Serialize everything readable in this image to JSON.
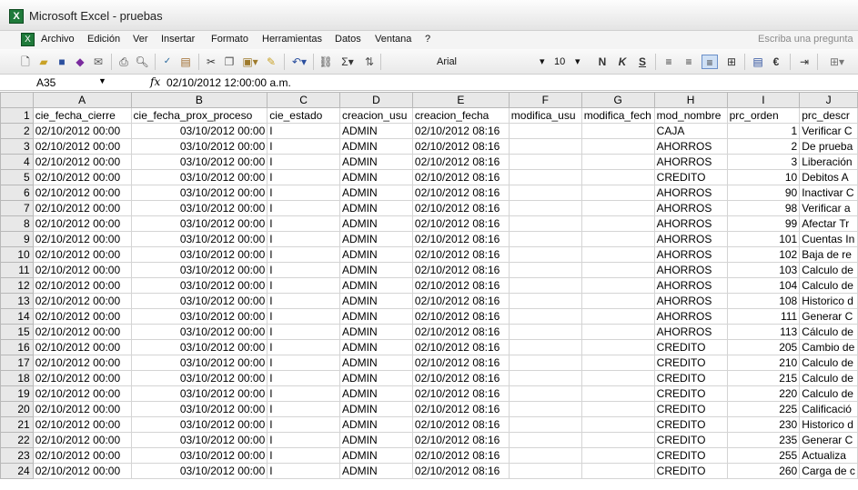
{
  "window": {
    "title": "Microsoft Excel - pruebas",
    "app_icon": "excel-icon"
  },
  "menu": {
    "items": [
      "Archivo",
      "Edición",
      "Ver",
      "Insertar",
      "Formato",
      "Herramientas",
      "Datos",
      "Ventana",
      "?"
    ],
    "help_placeholder": "Escriba una pregunta"
  },
  "toolbar": {
    "font_name": "Arial",
    "font_size": "10",
    "bold": "N",
    "italic": "K",
    "underline": "S",
    "sum": "Σ",
    "currency": "€"
  },
  "formula_bar": {
    "cell_ref": "A35",
    "fx": "fx",
    "value": "02/10/2012  12:00:00 a.m."
  },
  "sheet": {
    "columns": [
      "A",
      "B",
      "C",
      "D",
      "E",
      "F",
      "G",
      "H",
      "I",
      "J"
    ],
    "headers": [
      "cie_fecha_cierre",
      "cie_fecha_prox_proceso",
      "cie_estado",
      "creacion_usu",
      "creacion_fecha",
      "modifica_usu",
      "modifica_fech",
      "mod_nombre",
      "prc_orden",
      "prc_descr"
    ],
    "rows": [
      {
        "n": "2",
        "a": "02/10/2012 00:00",
        "b": "03/10/2012 00:00",
        "c": "I",
        "d": "ADMIN",
        "e": "02/10/2012 08:16",
        "f": "",
        "g": "",
        "h": "CAJA",
        "i": "1",
        "j": "Verificar C"
      },
      {
        "n": "3",
        "a": "02/10/2012 00:00",
        "b": "03/10/2012 00:00",
        "c": "I",
        "d": "ADMIN",
        "e": "02/10/2012 08:16",
        "f": "",
        "g": "",
        "h": "AHORROS",
        "i": "2",
        "j": "De prueba"
      },
      {
        "n": "4",
        "a": "02/10/2012 00:00",
        "b": "03/10/2012 00:00",
        "c": "I",
        "d": "ADMIN",
        "e": "02/10/2012 08:16",
        "f": "",
        "g": "",
        "h": "AHORROS",
        "i": "3",
        "j": "Liberación"
      },
      {
        "n": "5",
        "a": "02/10/2012 00:00",
        "b": "03/10/2012 00:00",
        "c": "I",
        "d": "ADMIN",
        "e": "02/10/2012 08:16",
        "f": "",
        "g": "",
        "h": "CREDITO",
        "i": "10",
        "j": "Debitos A"
      },
      {
        "n": "6",
        "a": "02/10/2012 00:00",
        "b": "03/10/2012 00:00",
        "c": "I",
        "d": "ADMIN",
        "e": "02/10/2012 08:16",
        "f": "",
        "g": "",
        "h": "AHORROS",
        "i": "90",
        "j": "Inactivar C"
      },
      {
        "n": "7",
        "a": "02/10/2012 00:00",
        "b": "03/10/2012 00:00",
        "c": "I",
        "d": "ADMIN",
        "e": "02/10/2012 08:16",
        "f": "",
        "g": "",
        "h": "AHORROS",
        "i": "98",
        "j": "Verificar a"
      },
      {
        "n": "8",
        "a": "02/10/2012 00:00",
        "b": "03/10/2012 00:00",
        "c": "I",
        "d": "ADMIN",
        "e": "02/10/2012 08:16",
        "f": "",
        "g": "",
        "h": "AHORROS",
        "i": "99",
        "j": "Afectar Tr"
      },
      {
        "n": "9",
        "a": "02/10/2012 00:00",
        "b": "03/10/2012 00:00",
        "c": "I",
        "d": "ADMIN",
        "e": "02/10/2012 08:16",
        "f": "",
        "g": "",
        "h": "AHORROS",
        "i": "101",
        "j": "Cuentas In"
      },
      {
        "n": "10",
        "a": "02/10/2012 00:00",
        "b": "03/10/2012 00:00",
        "c": "I",
        "d": "ADMIN",
        "e": "02/10/2012 08:16",
        "f": "",
        "g": "",
        "h": "AHORROS",
        "i": "102",
        "j": "Baja de re"
      },
      {
        "n": "11",
        "a": "02/10/2012 00:00",
        "b": "03/10/2012 00:00",
        "c": "I",
        "d": "ADMIN",
        "e": "02/10/2012 08:16",
        "f": "",
        "g": "",
        "h": "AHORROS",
        "i": "103",
        "j": "Calculo de"
      },
      {
        "n": "12",
        "a": "02/10/2012 00:00",
        "b": "03/10/2012 00:00",
        "c": "I",
        "d": "ADMIN",
        "e": "02/10/2012 08:16",
        "f": "",
        "g": "",
        "h": "AHORROS",
        "i": "104",
        "j": "Calculo de"
      },
      {
        "n": "13",
        "a": "02/10/2012 00:00",
        "b": "03/10/2012 00:00",
        "c": "I",
        "d": "ADMIN",
        "e": "02/10/2012 08:16",
        "f": "",
        "g": "",
        "h": "AHORROS",
        "i": "108",
        "j": "Historico d"
      },
      {
        "n": "14",
        "a": "02/10/2012 00:00",
        "b": "03/10/2012 00:00",
        "c": "I",
        "d": "ADMIN",
        "e": "02/10/2012 08:16",
        "f": "",
        "g": "",
        "h": "AHORROS",
        "i": "111",
        "j": "Generar C"
      },
      {
        "n": "15",
        "a": "02/10/2012 00:00",
        "b": "03/10/2012 00:00",
        "c": "I",
        "d": "ADMIN",
        "e": "02/10/2012 08:16",
        "f": "",
        "g": "",
        "h": "AHORROS",
        "i": "113",
        "j": "Cálculo de"
      },
      {
        "n": "16",
        "a": "02/10/2012 00:00",
        "b": "03/10/2012 00:00",
        "c": "I",
        "d": "ADMIN",
        "e": "02/10/2012 08:16",
        "f": "",
        "g": "",
        "h": "CREDITO",
        "i": "205",
        "j": "Cambio de"
      },
      {
        "n": "17",
        "a": "02/10/2012 00:00",
        "b": "03/10/2012 00:00",
        "c": "I",
        "d": "ADMIN",
        "e": "02/10/2012 08:16",
        "f": "",
        "g": "",
        "h": "CREDITO",
        "i": "210",
        "j": "Calculo de"
      },
      {
        "n": "18",
        "a": "02/10/2012 00:00",
        "b": "03/10/2012 00:00",
        "c": "I",
        "d": "ADMIN",
        "e": "02/10/2012 08:16",
        "f": "",
        "g": "",
        "h": "CREDITO",
        "i": "215",
        "j": "Calculo de"
      },
      {
        "n": "19",
        "a": "02/10/2012 00:00",
        "b": "03/10/2012 00:00",
        "c": "I",
        "d": "ADMIN",
        "e": "02/10/2012 08:16",
        "f": "",
        "g": "",
        "h": "CREDITO",
        "i": "220",
        "j": "Calculo de"
      },
      {
        "n": "20",
        "a": "02/10/2012 00:00",
        "b": "03/10/2012 00:00",
        "c": "I",
        "d": "ADMIN",
        "e": "02/10/2012 08:16",
        "f": "",
        "g": "",
        "h": "CREDITO",
        "i": "225",
        "j": "Calificació"
      },
      {
        "n": "21",
        "a": "02/10/2012 00:00",
        "b": "03/10/2012 00:00",
        "c": "I",
        "d": "ADMIN",
        "e": "02/10/2012 08:16",
        "f": "",
        "g": "",
        "h": "CREDITO",
        "i": "230",
        "j": "Historico d"
      },
      {
        "n": "22",
        "a": "02/10/2012 00:00",
        "b": "03/10/2012 00:00",
        "c": "I",
        "d": "ADMIN",
        "e": "02/10/2012 08:16",
        "f": "",
        "g": "",
        "h": "CREDITO",
        "i": "235",
        "j": "Generar C"
      },
      {
        "n": "23",
        "a": "02/10/2012 00:00",
        "b": "03/10/2012 00:00",
        "c": "I",
        "d": "ADMIN",
        "e": "02/10/2012 08:16",
        "f": "",
        "g": "",
        "h": "CREDITO",
        "i": "255",
        "j": "Actualiza"
      },
      {
        "n": "24",
        "a": "02/10/2012 00:00",
        "b": "03/10/2012 00:00",
        "c": "I",
        "d": "ADMIN",
        "e": "02/10/2012 08:16",
        "f": "",
        "g": "",
        "h": "CREDITO",
        "i": "260",
        "j": "Carga de c"
      }
    ]
  }
}
